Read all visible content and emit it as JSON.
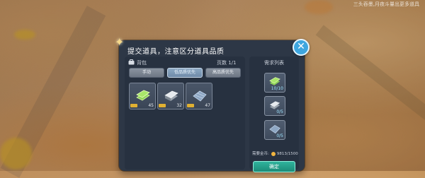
{
  "top_right_text": "三头吞墨,月夜斗量出更多道具",
  "dialog": {
    "title": "提交道具，注意区分道具品质",
    "close_glyph": "✕"
  },
  "bag": {
    "label": "背包",
    "page_text": "页数 1/1",
    "sort_buttons": [
      {
        "label": "手动",
        "active": false
      },
      {
        "label": "低品质优先",
        "active": true
      },
      {
        "label": "高品质优先",
        "active": false
      }
    ],
    "items": [
      {
        "icon": "green-ingot-icon",
        "count": "45"
      },
      {
        "icon": "silver-ingot-icon",
        "count": "32"
      },
      {
        "icon": "blue-ore-icon",
        "count": "47"
      }
    ]
  },
  "requirements": {
    "title": "需求列表",
    "items": [
      {
        "icon": "green-ingot-icon",
        "count": "10/10"
      },
      {
        "icon": "silver-ingot-icon",
        "count": "0/5"
      },
      {
        "icon": "blue-ore-icon",
        "count": "0/5"
      }
    ]
  },
  "coins": {
    "label": "需要金币:",
    "value": "9813/1500"
  },
  "confirm_label": "确定",
  "colors": {
    "panel": "#2d3746",
    "accent_close": "#3ea6df",
    "confirm": "#1c8b78",
    "coin": "#f0b440"
  }
}
